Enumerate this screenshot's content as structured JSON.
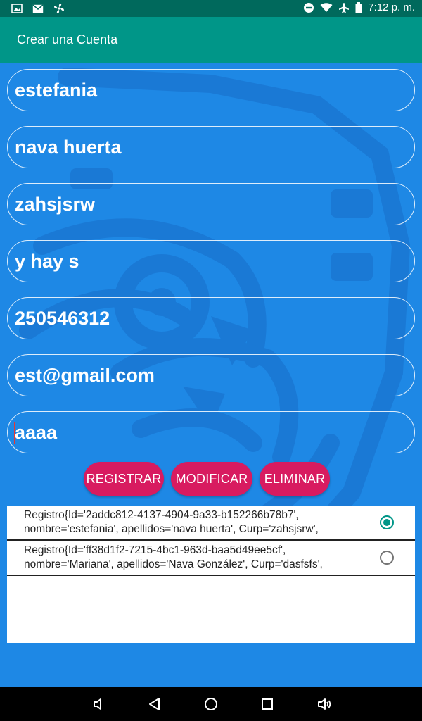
{
  "status_bar": {
    "time": "7:12 p. m.",
    "left_icons": [
      "photo-icon",
      "mail-icon",
      "fan-icon"
    ],
    "right_icons": [
      "do-not-disturb-icon",
      "wifi-icon",
      "airplane-icon",
      "battery-icon"
    ]
  },
  "app_bar": {
    "title": "Crear una Cuenta"
  },
  "form": {
    "fields": [
      {
        "value": "estefania"
      },
      {
        "value": "nava huerta"
      },
      {
        "value": "zahsjsrw"
      },
      {
        "value": "y hay s"
      },
      {
        "value": "250546312"
      },
      {
        "value": "est@gmail.com"
      },
      {
        "value": "aaaa"
      }
    ]
  },
  "buttons": {
    "register": "REGISTRAR",
    "modify": "MODIFICAR",
    "delete": "ELIMINAR"
  },
  "records": [
    {
      "line1": "Registro{Id='2addc812-4137-4904-9a33-b152266b78b7',",
      "line2": "nombre='estefania', apellidos='nava huerta', Curp='zahsjsrw',",
      "selected": true
    },
    {
      "line1": "Registro{Id='ff38d1f2-7215-4bc1-963d-baa5d49ee5cf',",
      "line2": "nombre='Mariana', apellidos='Nava González', Curp='dasfsfs',",
      "selected": false
    }
  ],
  "colors": {
    "status_bar": "#00695c",
    "app_bar": "#009688",
    "background": "#1e88e5",
    "button": "#d81b60",
    "radio_accent": "#009688"
  },
  "nav_bar": {
    "icons": [
      "volume-down-icon",
      "back-icon",
      "home-icon",
      "recents-icon",
      "volume-up-icon"
    ]
  }
}
